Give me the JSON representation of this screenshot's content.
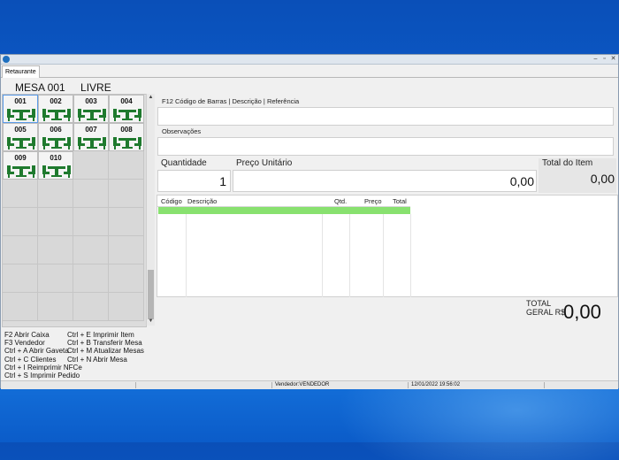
{
  "window": {
    "tab_label": "Retaurante",
    "min_glyph": "–",
    "restore_glyph": "▫",
    "close_glyph": "✕"
  },
  "mesa": {
    "title": "MESA 001",
    "status": "LIVRE"
  },
  "tables": [
    {
      "label": "001"
    },
    {
      "label": "002"
    },
    {
      "label": "003"
    },
    {
      "label": "004"
    },
    {
      "label": "005"
    },
    {
      "label": "006"
    },
    {
      "label": "007"
    },
    {
      "label": "008"
    },
    {
      "label": "009"
    },
    {
      "label": "010"
    }
  ],
  "scroll": {
    "up": "▲",
    "down": "▼"
  },
  "shortcuts": {
    "col1": [
      "F2 Abrir Caixa",
      "F3 Vendedor",
      "Ctrl + A  Abrir Gaveta",
      "Ctrl + C  Clientes",
      "Ctrl + I  Reimprimir NFCe",
      "Ctrl + S  Imprimir Pedido"
    ],
    "col2": [
      "Ctrl + E  Imprimir Item",
      "Ctrl + B  Transferir Mesa",
      "Ctrl + M  Atualizar Mesas",
      "Ctrl + N  Abrir Mesa"
    ]
  },
  "search": {
    "label": "F12 Código de Barras | Descrição | Referência",
    "value": ""
  },
  "observacoes": {
    "label": "Observações",
    "value": ""
  },
  "quantidade": {
    "label": "Quantidade",
    "value": "1"
  },
  "preco_unitario": {
    "label": "Preço Unitário",
    "value": "0,00"
  },
  "total_item": {
    "label": "Total do Item",
    "value": "0,00"
  },
  "items_table": {
    "columns": [
      "Código",
      "Descrição",
      "Qtd.",
      "Preço",
      "Total"
    ]
  },
  "total_geral": {
    "label_line1": "TOTAL",
    "label_line2": "GERAL R$",
    "value": "0,00"
  },
  "statusbar": {
    "vendedor": "Vendedor:VENDEDOR",
    "datetime": "12/01/2022 19:56:02"
  },
  "colors": {
    "selected_row": "#88e16f",
    "table_icon": "#1f7a2e",
    "desktop": "#0d64d6"
  }
}
